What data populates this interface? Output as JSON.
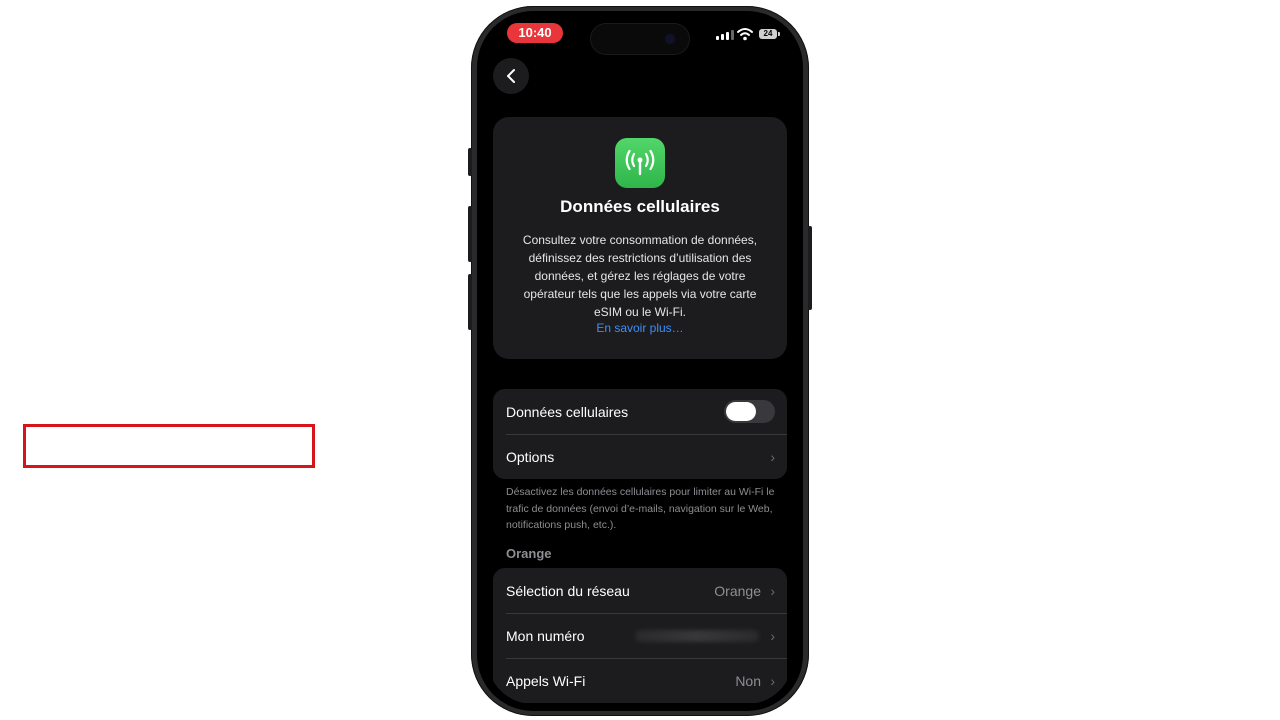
{
  "status": {
    "time": "10:40",
    "battery": "24"
  },
  "hero": {
    "title": "Données cellulaires",
    "description": "Consultez votre consommation de données, définissez des restrictions d’utilisation des données, et gérez les réglages de votre opérateur tels que les appels via votre carte eSIM ou le Wi‑Fi.",
    "link": "En savoir plus…",
    "icon": "antenna-icon",
    "icon_color": "#34c759"
  },
  "main_group": {
    "toggle_label": "Données cellulaires",
    "toggle_on": false,
    "options_label": "Options"
  },
  "footnote": "Désactivez les données cellulaires pour limiter au Wi‑Fi le trafic de données (envoi d’e‑mails, navigation sur le Web, notifications push, etc.).",
  "carrier_section": {
    "header": "Orange",
    "rows": [
      {
        "label": "Sélection du réseau",
        "value": "Orange"
      },
      {
        "label": "Mon numéro",
        "value": ""
      },
      {
        "label": "Appels Wi‑Fi",
        "value": "Non"
      }
    ]
  },
  "colors": {
    "highlight": "#d8141b",
    "link": "#3e8ef7",
    "time_badge": "#e8363a"
  }
}
